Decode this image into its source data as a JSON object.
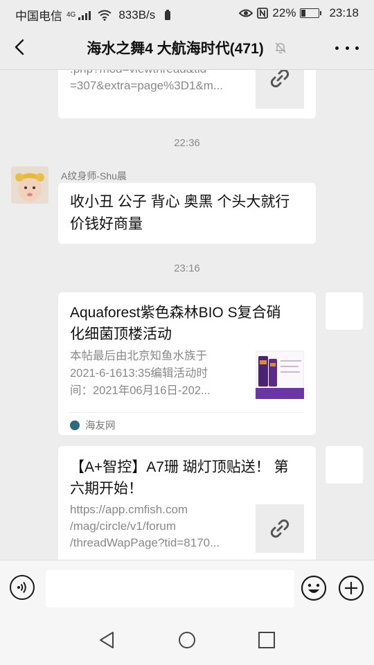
{
  "status_bar": {
    "carrier": "中国电信",
    "network": "4G",
    "speed": "833B/s",
    "battery": "22%",
    "time": "23:18"
  },
  "header": {
    "title": "海水之舞4 大航海时代(471)",
    "back_icon": "chevron-left-icon",
    "mute_icon": "bell-off-icon",
    "more_icon": "more-dots-icon"
  },
  "messages": {
    "partial_link": {
      "lines": [
        ".php?mod=viewthread&tid",
        "=307&extra=page%3D1&m..."
      ]
    },
    "ts1": "22:36",
    "text_msg": {
      "sender": "A纹身师-Shu晨",
      "text_line1": "收小丑 公子 背心 奥黑 个头大就行",
      "text_line2": "价钱好商量"
    },
    "ts2": "23:16",
    "share1": {
      "title_line1": "Aquaforest紫色森林BIO S复合硝",
      "title_line2": "化细菌顶楼活动",
      "desc_line1": "本帖最后由北京知鱼水族于",
      "desc_line2": "2021-6-1613:35编辑活动时",
      "desc_line3": "间：2021年06月16日-202...",
      "source": "海友网"
    },
    "share2": {
      "title_line1": "【A+智控】A7珊 瑚灯顶贴送！ 第",
      "title_line2": "六期开始！",
      "url_line1": "https://app.cmfish.com",
      "url_line2": "/mag/circle/v1/forum",
      "url_line3": "/threadWapPage?tid=8170..."
    }
  },
  "input_bar": {
    "voice_icon": "voice-icon",
    "emoji_icon": "emoji-icon",
    "plus_icon": "plus-icon"
  },
  "system_nav": {
    "back": "triangle-back-icon",
    "home": "circle-home-icon",
    "recent": "square-recent-icon"
  }
}
